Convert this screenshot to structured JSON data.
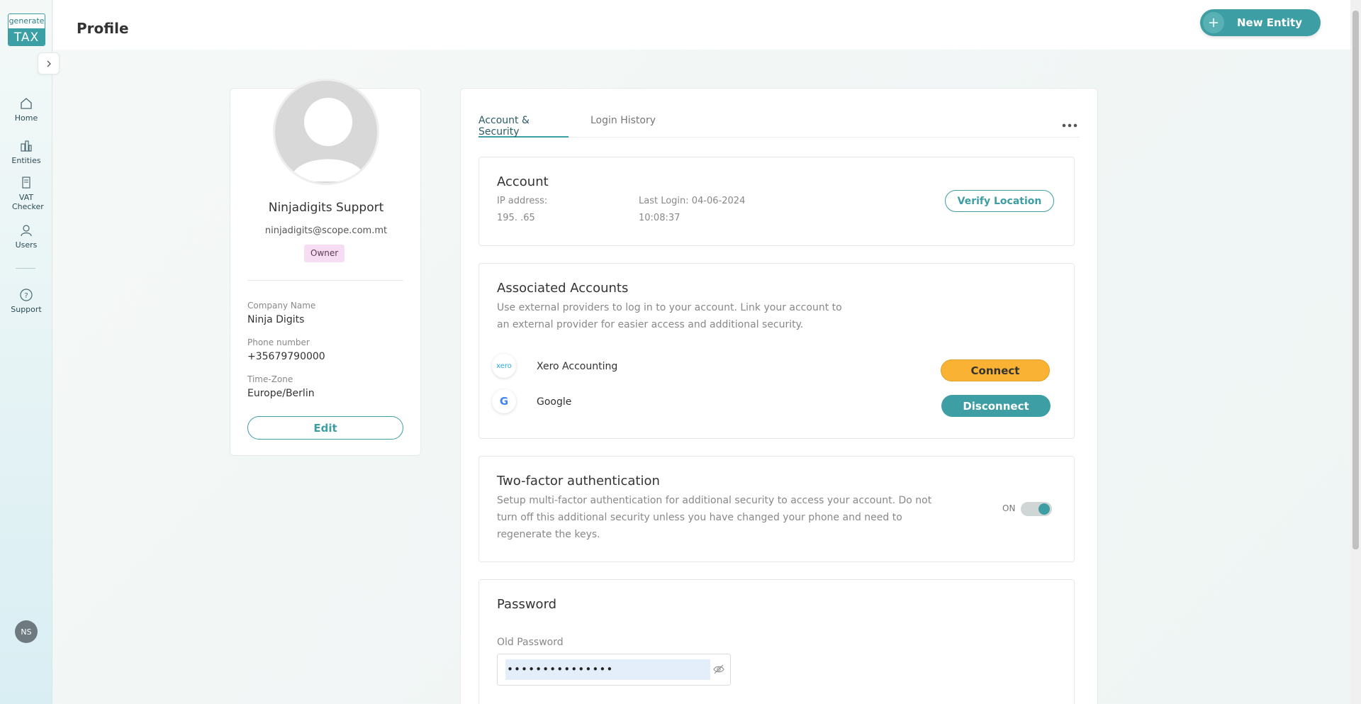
{
  "app": {
    "logo_top": "generate",
    "logo_bottom": "TAX"
  },
  "header": {
    "title": "Profile",
    "new_entity_label": "New Entity"
  },
  "sidebar": {
    "items": [
      {
        "label": "Home",
        "icon": "home-icon"
      },
      {
        "label": "Entities",
        "icon": "buildings-icon"
      },
      {
        "label": "VAT Checker",
        "icon": "document-icon"
      },
      {
        "label": "Users",
        "icon": "user-icon"
      },
      {
        "label": "Support",
        "icon": "help-icon"
      }
    ],
    "user_initials": "NS"
  },
  "profile": {
    "name": "Ninjadigits Support",
    "email": "ninjadigits@scope.com.mt",
    "role": "Owner",
    "company_label": "Company Name",
    "company_value": "Ninja Digits",
    "phone_label": "Phone number",
    "phone_value": "+35679790000",
    "timezone_label": "Time-Zone",
    "timezone_value": "Europe/Berlin",
    "edit_label": "Edit"
  },
  "tabs": [
    {
      "label": "Account & Security",
      "active": true
    },
    {
      "label": "Login History",
      "active": false
    }
  ],
  "account": {
    "title": "Account",
    "ip_label": "IP address:",
    "ip_value": "195.        .65",
    "last_login_label": "Last Login: 04-06-2024",
    "last_login_time": "10:08:37",
    "verify_label": "Verify Location"
  },
  "associated": {
    "title": "Associated Accounts",
    "desc_line1": "Use external providers to log in to your account. Link your account to",
    "desc_line2": "an external provider for easier access and additional security.",
    "providers": [
      {
        "name": "Xero Accounting",
        "logo_text": "xero",
        "action": "Connect"
      },
      {
        "name": "Google",
        "logo_text": "G",
        "action": "Disconnect"
      }
    ]
  },
  "twofa": {
    "title": "Two-factor authentication",
    "desc_line1": "Setup multi-factor authentication for additional security to access your account. Do not",
    "desc_line2": "turn off this additional security unless you have changed your phone and need to",
    "desc_line3": "regenerate the keys.",
    "status_label": "ON",
    "enabled": true
  },
  "password": {
    "title": "Password",
    "old_label": "Old Password",
    "old_value": "•••••••••••••••"
  },
  "colors": {
    "accent": "#3d9ea3",
    "connect": "#f9b234",
    "badge": "#f7ddf3"
  }
}
